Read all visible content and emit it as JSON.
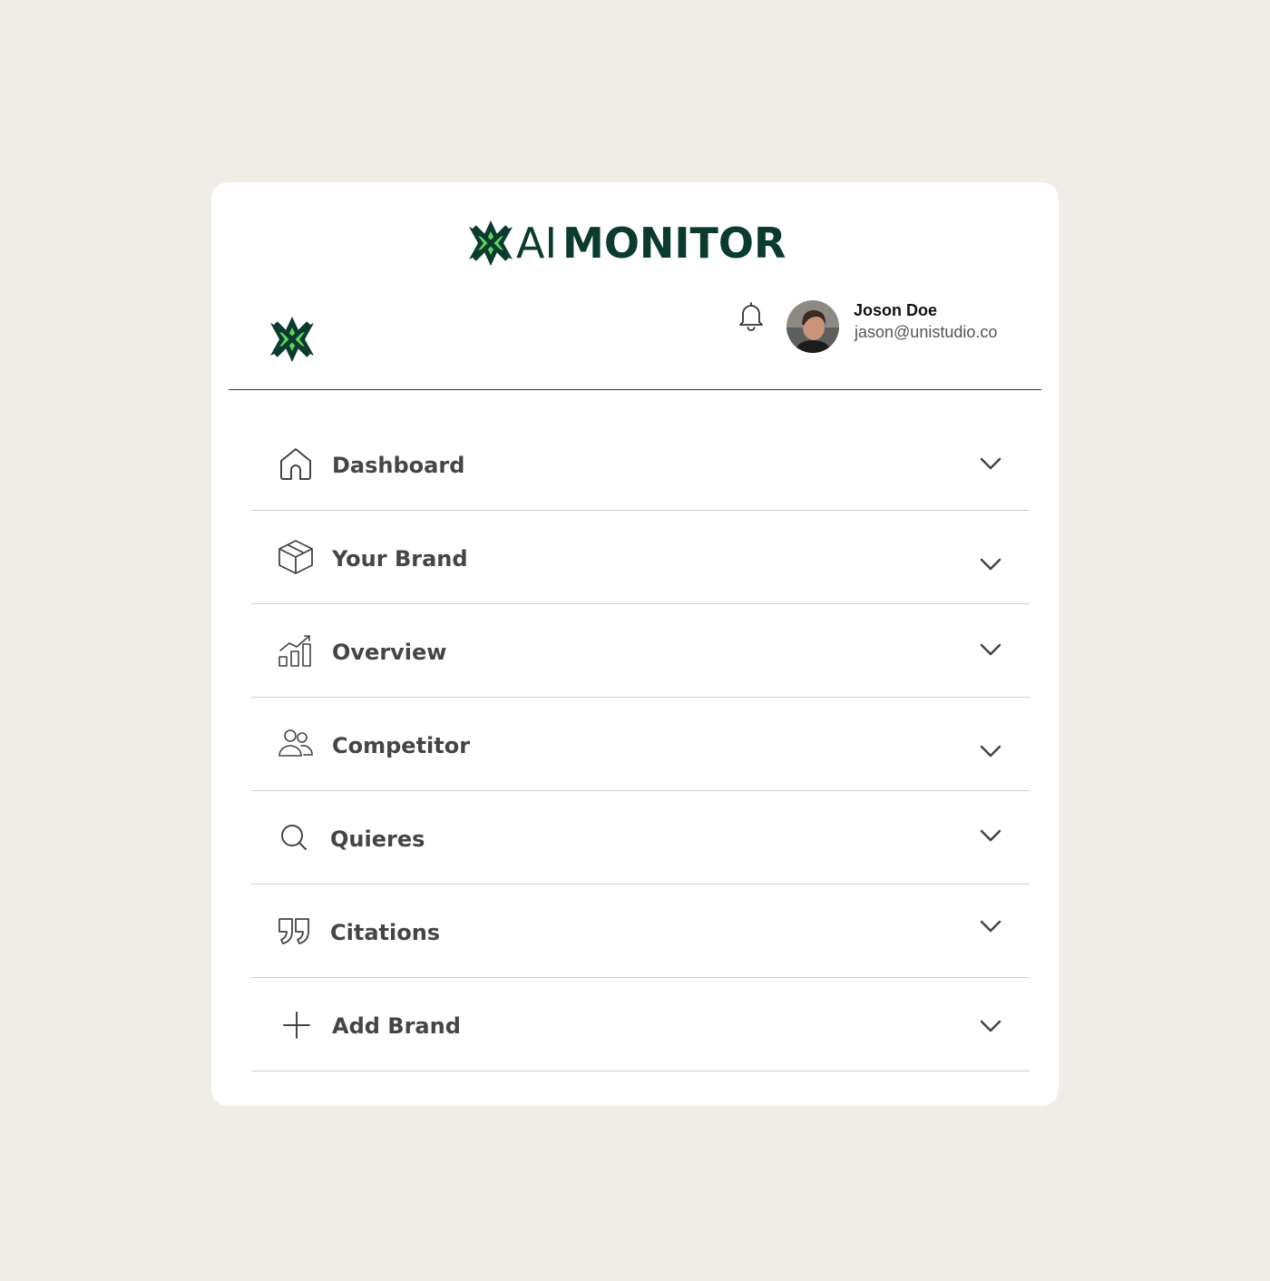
{
  "brand": {
    "logo_ai": "AI",
    "logo_monitor": "MONITOR",
    "colors": {
      "dark": "#0b3b2e",
      "light": "#5fd35a"
    }
  },
  "header": {
    "notification_icon": "bell-icon",
    "user": {
      "name": "Joson Doe",
      "email": "jason@unistudio.co"
    }
  },
  "menu": {
    "items": [
      {
        "label": "Dashboard",
        "icon": "home-icon"
      },
      {
        "label": "Your Brand",
        "icon": "box-icon"
      },
      {
        "label": "Overview",
        "icon": "bar-chart-icon"
      },
      {
        "label": "Competitor",
        "icon": "users-icon"
      },
      {
        "label": "Quieres",
        "icon": "search-icon"
      },
      {
        "label": "Citations",
        "icon": "quote-icon"
      },
      {
        "label": "Add Brand",
        "icon": "plus-icon"
      }
    ]
  }
}
